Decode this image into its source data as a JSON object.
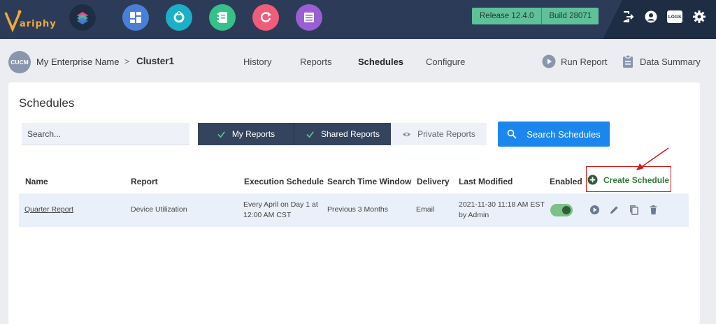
{
  "topbar": {
    "logo_text": "ariphy",
    "apps": [
      {
        "name": "layers-app-icon",
        "color": "#1f2d44"
      },
      {
        "name": "dashboard-app-icon",
        "color": "#4a7fd8"
      },
      {
        "name": "sync-app-icon",
        "color": "#1ab0c8"
      },
      {
        "name": "directory-app-icon",
        "color": "#34c28a"
      },
      {
        "name": "refresh-app-icon",
        "color": "#f05c7a"
      },
      {
        "name": "table-app-icon",
        "color": "#9a5fd4"
      }
    ],
    "release": "Release 12.4.0",
    "build": "Build 28071",
    "logs_label": "LOGS"
  },
  "breadcrumb": {
    "badge": "CUCM",
    "enterprise": "My Enterprise Name",
    "separator": ">",
    "cluster": "Cluster1"
  },
  "nav": {
    "history": "History",
    "reports": "Reports",
    "schedules": "Schedules",
    "configure": "Configure"
  },
  "actions": {
    "run_report": "Run Report",
    "data_summary": "Data Summary"
  },
  "main": {
    "title": "Schedules",
    "search_placeholder": "Search...",
    "filters": {
      "my_reports": "My Reports",
      "shared_reports": "Shared Reports",
      "private_reports": "Private Reports"
    },
    "search_button": "Search Schedules",
    "create_button": "Create Schedule",
    "columns": {
      "name": "Name",
      "report": "Report",
      "execution": "Execution Schedule",
      "window": "Search Time Window",
      "delivery": "Delivery",
      "modified": "Last Modified",
      "enabled": "Enabled"
    },
    "rows": [
      {
        "name": "Quarter Report",
        "report": "Device Utilization",
        "execution_1": "Every April on Day 1 at",
        "execution_2": "12:00 AM CST",
        "window": "Previous 3 Months",
        "delivery": "Email",
        "modified_1": "2021-11-30 11:18 AM EST",
        "modified_2": "by Admin",
        "enabled": true
      }
    ]
  },
  "colors": {
    "topbar": "#2c3c58",
    "accent_blue": "#1a86ee",
    "segment_dark": "#34435e",
    "release_green": "#5fc09a",
    "highlight_red": "#d11a1a",
    "create_green": "#2e7d32"
  }
}
